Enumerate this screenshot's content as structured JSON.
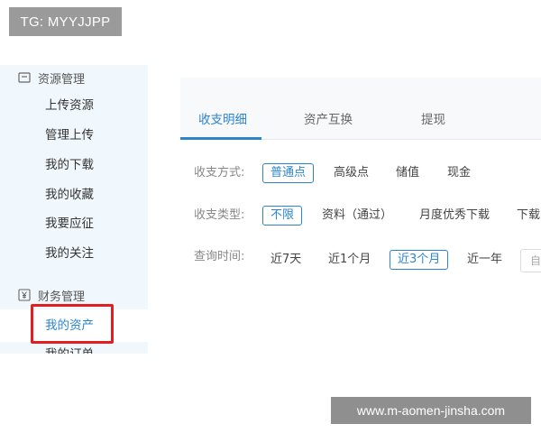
{
  "overlay": {
    "tg_label": "TG: MYYJJPP",
    "watermark": "www.m-aomen-jinsha.com"
  },
  "sidebar": {
    "resource_section": {
      "label": "资源管理",
      "icon": "resource-icon"
    },
    "resource_items": [
      "上传资源",
      "管理上传",
      "我的下载",
      "我的收藏",
      "我要应征",
      "我的关注"
    ],
    "finance_section": {
      "label": "财务管理",
      "icon": "yen-icon"
    },
    "finance_items": [
      "我的资产",
      "我的订单"
    ],
    "active_item": "我的资产"
  },
  "tabs": {
    "items": [
      "收支明细",
      "资产互换",
      "提现"
    ],
    "active": "收支明细"
  },
  "filters": {
    "mode": {
      "label": "收支方式:",
      "options": [
        "普通点",
        "高级点",
        "储值",
        "现金"
      ],
      "selected": "普通点"
    },
    "type": {
      "label": "收支类型:",
      "options": [
        "不限",
        "资料（通过）",
        "月度优秀下载",
        "下载"
      ],
      "selected": "不限"
    },
    "time": {
      "label": "查询时间:",
      "options": [
        "近7天",
        "近1个月",
        "近3个月",
        "近一年"
      ],
      "selected": "近3个月"
    },
    "date_placeholder": "自"
  },
  "colors": {
    "accent": "#2d84cc",
    "highlight_box": "#e02020",
    "sidebar_bg": "#f1f8fd"
  }
}
